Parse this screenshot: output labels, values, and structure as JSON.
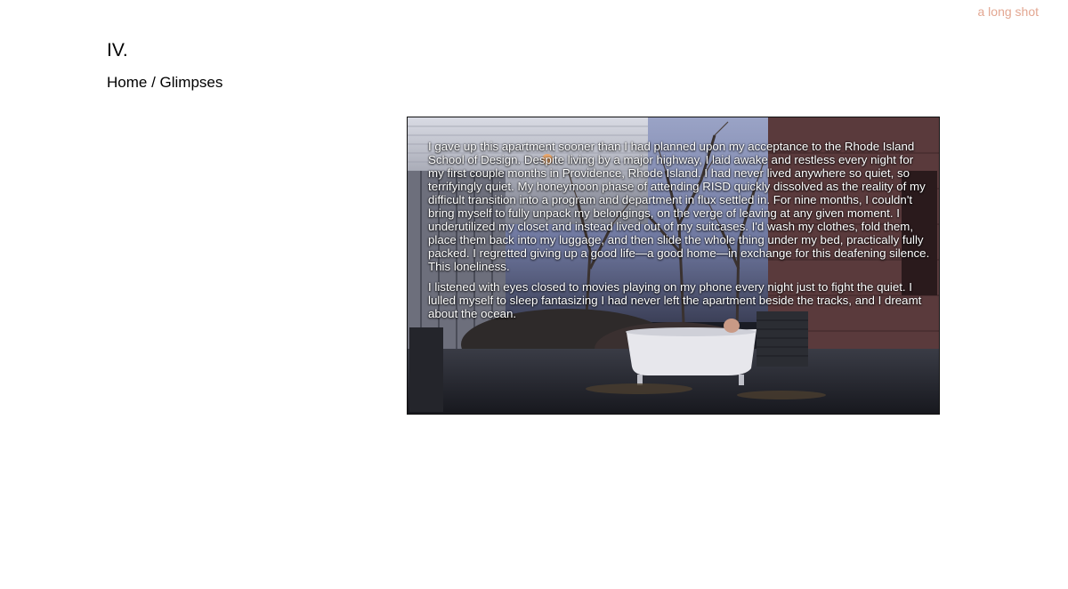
{
  "header": {
    "site_link": "a long shot",
    "chapter": "IV.",
    "breadcrumb": {
      "home": "Home",
      "separator": " / ",
      "current": "Glimpses"
    }
  },
  "media": {
    "scene_description_icon": "backyard-bathtub-photo",
    "paragraphs": [
      "I gave up this apartment sooner than I had planned upon my acceptance to the Rhode Island School of Design. Despite living by a major highway, I laid awake and restless every night for my first couple months in Providence, Rhode Island. I had never lived anywhere so quiet, so terrifyingly quiet. My honeymoon phase of attending RISD quickly dissolved as the reality of my difficult transition into a program and department in flux settled in. For nine months, I couldn't bring myself to fully unpack my belongings, on the verge of leaving at any given moment. I underutilized my closet and instead lived out of my suitcases. I'd wash my clothes, fold them, place them back into my luggage, and then slide the whole thing under my bed, practically fully packed. I regretted giving up a good life—a good home—in exchange for this deafening silence. This loneliness.",
      "I listened with eyes closed to movies playing on my phone every night just to fight the quiet. I lulled myself to sleep fantasizing I had never left the apartment beside the tracks, and I dreamt about the ocean."
    ]
  },
  "colors": {
    "accent_link": "#e3a792",
    "text": "#000000",
    "overlay_text": "#ffffff"
  }
}
